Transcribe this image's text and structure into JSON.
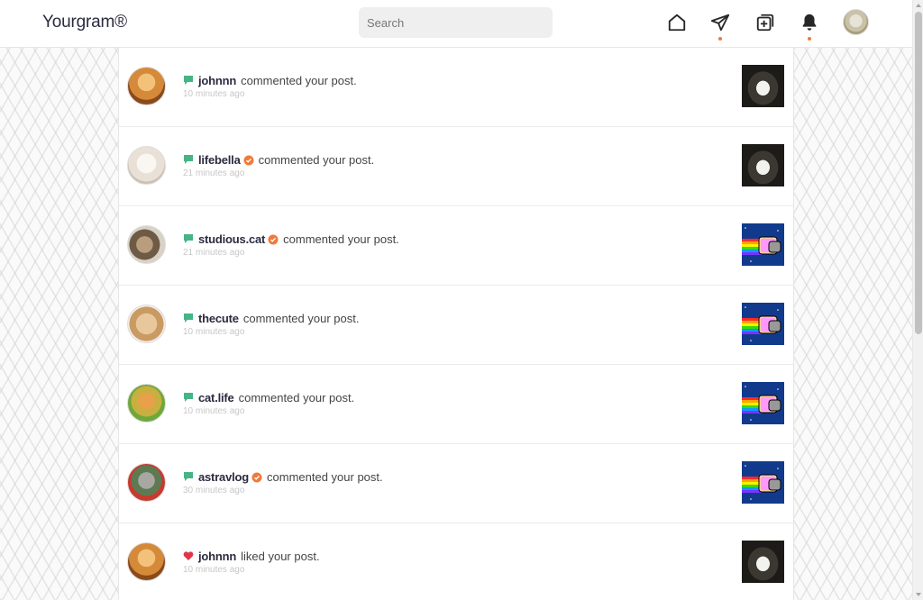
{
  "header": {
    "logo": "Yourgram®",
    "search_placeholder": "Search",
    "nav": [
      "home-icon",
      "send-icon",
      "add-post-icon",
      "bell-icon"
    ],
    "accent_color": "#f07a3a"
  },
  "notifications": [
    {
      "type": "comment",
      "user": "johnnn",
      "verified": false,
      "action": "commented your post.",
      "time": "10 minutes ago",
      "avatar": "orange-cat",
      "thumb": "kitten-photo"
    },
    {
      "type": "comment",
      "user": "lifebella",
      "verified": true,
      "action": "commented your post.",
      "time": "21 minutes ago",
      "avatar": "white-cat",
      "thumb": "kitten-photo"
    },
    {
      "type": "comment",
      "user": "studious.cat",
      "verified": true,
      "action": "commented your post.",
      "time": "21 minutes ago",
      "avatar": "tabby-cat",
      "thumb": "nyan-cat"
    },
    {
      "type": "comment",
      "user": "thecute",
      "verified": false,
      "action": "commented your post.",
      "time": "10 minutes ago",
      "avatar": "beige-cat",
      "thumb": "nyan-cat"
    },
    {
      "type": "comment",
      "user": "cat.life",
      "verified": false,
      "action": "commented your post.",
      "time": "10 minutes ago",
      "avatar": "garden-cat",
      "thumb": "nyan-cat"
    },
    {
      "type": "comment",
      "user": "astravlog",
      "verified": true,
      "action": "commented your post.",
      "time": "30 minutes ago",
      "avatar": "flower-crown-cat",
      "thumb": "nyan-cat"
    },
    {
      "type": "like",
      "user": "johnnn",
      "verified": false,
      "action": "liked your post.",
      "time": "10 minutes ago",
      "avatar": "orange-cat",
      "thumb": "kitten-photo"
    }
  ],
  "colors": {
    "comment_icon": "#47b485",
    "like_icon": "#e0364a",
    "verified_badge": "#f07a3a",
    "username": "#2b2b40"
  }
}
